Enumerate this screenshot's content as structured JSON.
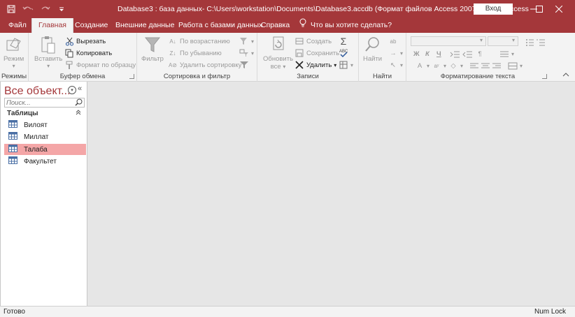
{
  "window": {
    "title": "Database3 : база данных- C:\\Users\\workstation\\Documents\\Database3.accdb (Формат файлов Access 2007–2016)  -  Access",
    "signin_label": "Вход",
    "accent_color": "#a4373a"
  },
  "quick_access": {
    "icons": [
      "save-icon",
      "undo-icon",
      "redo-icon",
      "customize-icon"
    ]
  },
  "tabs": {
    "file": "Файл",
    "home": "Главная",
    "create": "Создание",
    "external": "Внешние данные",
    "database_tools": "Работа с базами данных",
    "help": "Справка",
    "tell_me": "Что вы хотите сделать?"
  },
  "ribbon": {
    "views": {
      "mode": "Режим",
      "label": "Режимы"
    },
    "clipboard": {
      "paste": "Вставить",
      "cut": "Вырезать",
      "copy": "Копировать",
      "format_painter": "Формат по образцу",
      "label": "Буфер обмена"
    },
    "sort_filter": {
      "filter": "Фильтр",
      "ascending": "По возрастанию",
      "descending": "По убыванию",
      "remove_sort": "Удалить сортировку",
      "label": "Сортировка и фильтр"
    },
    "records": {
      "refresh": "Обновить",
      "refresh_2": "все",
      "new": "Создать",
      "save": "Сохранить",
      "delete": "Удалить",
      "label": "Записи"
    },
    "find": {
      "find": "Найти",
      "label": "Найти"
    },
    "text_formatting": {
      "bold": "Ж",
      "italic": "К",
      "underline": "Ч",
      "label": "Форматирование текста"
    }
  },
  "nav": {
    "title": "Все объект...",
    "search_placeholder": "Поиск...",
    "section": "Таблицы",
    "items": [
      {
        "label": "Вилоят",
        "selected": false
      },
      {
        "label": "Миллат",
        "selected": false
      },
      {
        "label": "Талаба",
        "selected": true
      },
      {
        "label": "Факультет",
        "selected": false
      }
    ]
  },
  "status": {
    "left": "Готово",
    "right": "Num Lock"
  }
}
